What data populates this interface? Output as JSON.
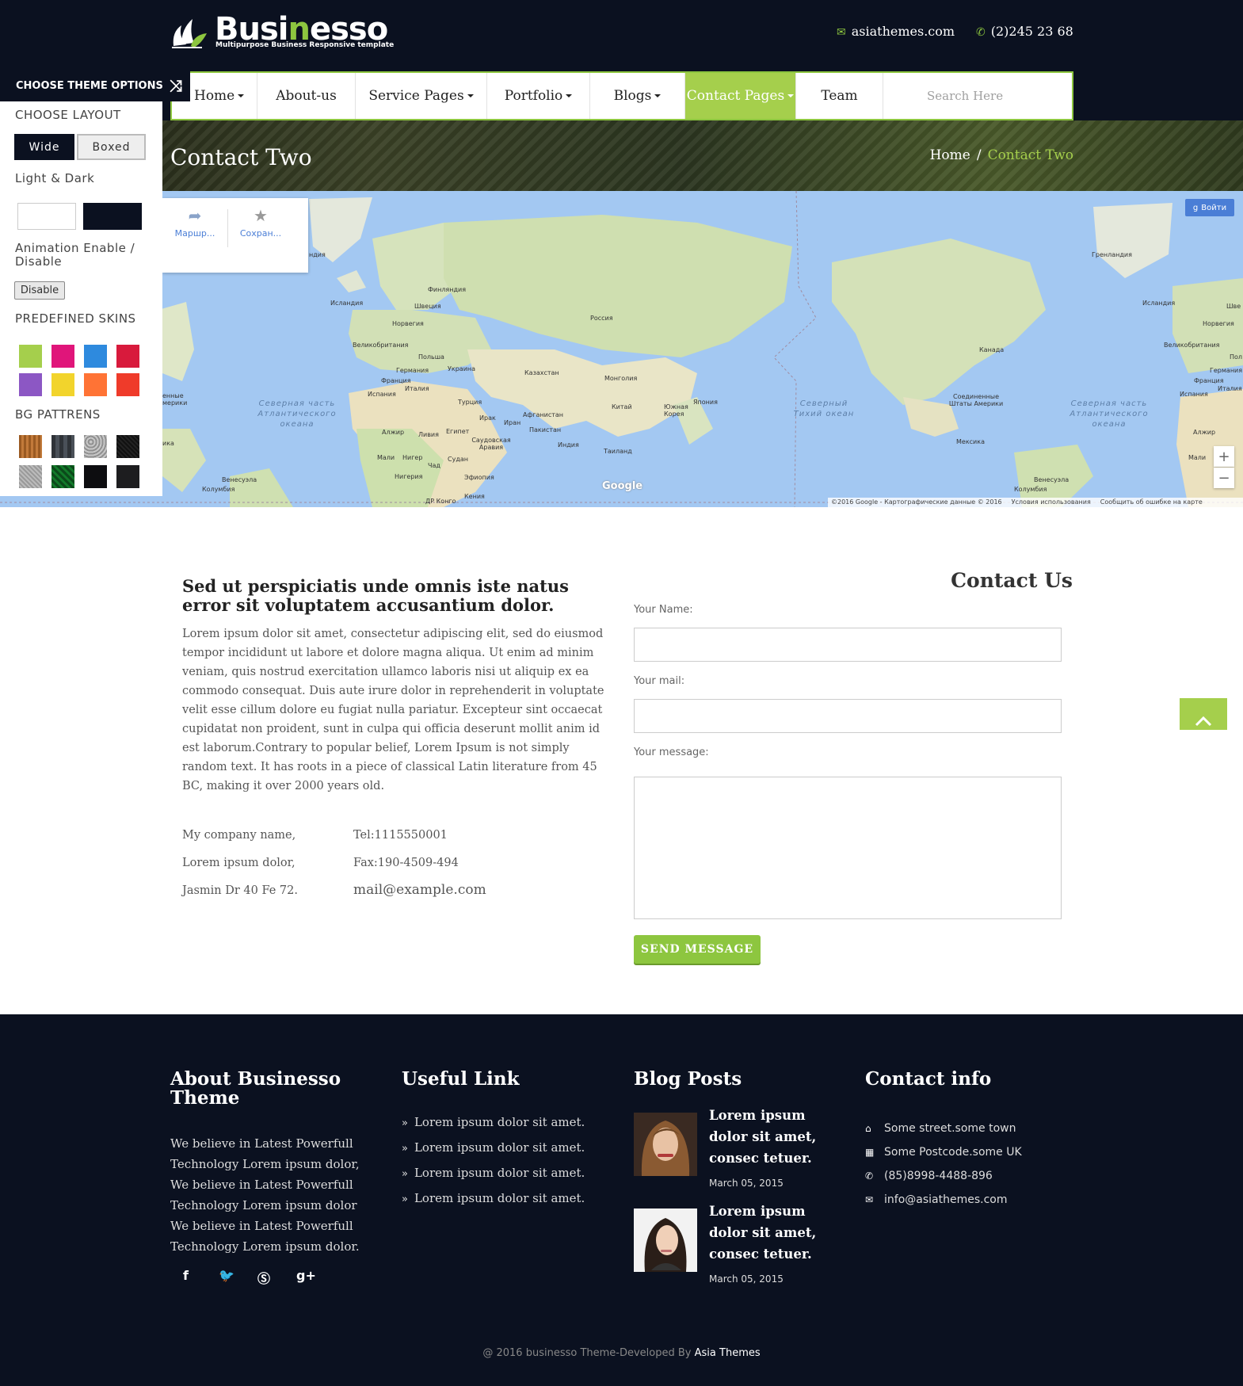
{
  "header": {
    "logo_main_pre": "Busi",
    "logo_main_accent": "n",
    "logo_main_post": "esso",
    "logo_tagline": "Multipurpose Business Responsive template",
    "email": "asiathemes.com",
    "phone": "(2)245 23 68"
  },
  "nav": {
    "items": [
      {
        "label": "Home",
        "dropdown": true
      },
      {
        "label": "About-us",
        "dropdown": false
      },
      {
        "label": "Service Pages",
        "dropdown": true
      },
      {
        "label": "Portfolio",
        "dropdown": true
      },
      {
        "label": "Blogs",
        "dropdown": true
      },
      {
        "label": "Contact Pages",
        "dropdown": true,
        "active": true
      },
      {
        "label": "Team",
        "dropdown": false
      }
    ],
    "search_placeholder": "Search Here"
  },
  "banner": {
    "title": "Contact Two",
    "breadcrumb_home": "Home",
    "breadcrumb_sep": "/",
    "breadcrumb_current": "Contact Two"
  },
  "map": {
    "route_label": "Маршр...",
    "save_label": "Сохран...",
    "login_label": "Войти",
    "zoom_in": "+",
    "zoom_out": "−",
    "watermark": "Google",
    "attribution": [
      "©2016 Google - Картографические данные © 2016",
      "Условия использования",
      "Сообщить об ошибке на карте"
    ],
    "labels": {
      "greenland_l": "ндия",
      "iceland_l": "Исландия",
      "norway_l": "Норвегия",
      "sweden_l": "Швеция",
      "finland_l": "Финляндия",
      "russia": "Россия",
      "uk_l": "Великобритания",
      "poland": "Польша",
      "germany_l": "Германия",
      "ukraine": "Украина",
      "france_l": "Франция",
      "italy_l": "Италия",
      "spain_l": "Испания",
      "kazakhstan": "Казахстан",
      "mongolia": "Монголия",
      "turkey": "Турция",
      "china": "Китай",
      "skorea": "Южная Корея",
      "japan": "Япония",
      "iraq": "Ирак",
      "iran": "Иран",
      "afghanistan": "Афганистан",
      "pakistan": "Пакистан",
      "india": "Индия",
      "thailand": "Таиланд",
      "saudi": "Саудовская Аравия",
      "egypt": "Египет",
      "libya": "Ливия",
      "algeria_l": "Алжир",
      "mali_l": "Мали",
      "niger": "Нигер",
      "chad": "Чад",
      "sudan": "Судан",
      "nigeria": "Нигерия",
      "ethiopia": "Эфиопия",
      "kenya": "Кения",
      "drc": "ДР Конго",
      "venezuela_l": "Венесуэла",
      "colombia_l": "Колумбия",
      "na_l": "енные мерики",
      "africa_l": "ика",
      "greenland_r": "Гренландия",
      "iceland_r": "Исландия",
      "norway_r": "Норвегия",
      "uk_r": "Великобритания",
      "germany_r": "Германия",
      "france_r": "Франция",
      "italy_r": "Италия",
      "spain_r": "Испания",
      "canada": "Канада",
      "usa": "Соединенные Штаты Америки",
      "mexico": "Мексика",
      "venezuela_r": "Венесуэла",
      "colombia_r": "Колумбия",
      "algeria_r": "Алжир",
      "mali_r": "Мали",
      "shve_r": "Шве",
      "pol_r": "Пол",
      "atl_l": "Северная часть Атлантического океана",
      "pacific": "Северный Тихий океан",
      "atl_r": "Северная часть Атлантического океана"
    }
  },
  "theme_panel": {
    "title": "CHOOSE THEME OPTIONS",
    "choose_layout": "CHOOSE LAYOUT",
    "wide": "Wide",
    "boxed": "Boxed",
    "light_dark": "Light & Dark",
    "animation": "Animation Enable / Disable",
    "disable": "Disable",
    "predefined_skins": "PREDEFINED SKINS",
    "bg_patterns": "BG PATTRENS",
    "skins": [
      "#a5cf4c",
      "#e0157a",
      "#2e8ade",
      "#d81a3c",
      "#8c57c4",
      "#f2d42c",
      "#ff7335",
      "#ef3b2a"
    ]
  },
  "content": {
    "heading": "Sed ut perspiciatis unde omnis iste natus error sit voluptatem accusantium dolor.",
    "paragraph": "Lorem ipsum dolor sit amet, consectetur adipiscing elit, sed do eiusmod tempor incididunt ut labore et dolore magna aliqua. Ut enim ad minim veniam, quis nostrud exercitation ullamco laboris nisi ut aliquip ex ea commodo consequat. Duis aute irure dolor in reprehenderit in voluptate velit esse cillum dolore eu fugiat nulla pariatur. Excepteur sint occaecat cupidatat non proident, sunt in culpa qui officia deserunt mollit anim id est laborum.Contrary to popular belief, Lorem Ipsum is not simply random text. It has roots in a piece of classical Latin literature from 45 BC, making it over 2000 years old.",
    "address": {
      "company": "My company name,",
      "line2": "Lorem ipsum dolor,",
      "line3": "Jasmin Dr 40 Fe 72.",
      "tel": "Tel:1115550001",
      "fax": "Fax:190-4509-494",
      "mail": "mail@example.com"
    }
  },
  "form": {
    "title": "Contact Us",
    "name_label": "Your Name:",
    "mail_label": "Your mail:",
    "message_label": "Your message:",
    "name_value": "",
    "mail_value": "",
    "message_value": "",
    "send": "SEND MESSAGE"
  },
  "footer": {
    "about_title": "About Businesso Theme",
    "about_text": "We believe in Latest Powerfull Technology Lorem ipsum dolor, We believe in Latest Powerfull Technology Lorem ipsum dolor We believe in Latest Powerfull Technology Lorem ipsum dolor.",
    "useful_title": "Useful Link",
    "links": [
      "Lorem ipsum dolor sit amet.",
      "Lorem ipsum dolor sit amet.",
      "Lorem ipsum dolor sit amet.",
      "Lorem ipsum dolor sit amet."
    ],
    "blog_title": "Blog Posts",
    "posts": [
      {
        "title": "Lorem ipsum dolor sit amet, consec tetuer.",
        "date": "March 05, 2015"
      },
      {
        "title": "Lorem ipsum dolor sit amet, consec tetuer.",
        "date": "March 05, 2015"
      }
    ],
    "contact_title": "Contact info",
    "contact": {
      "street": "Some street.some town",
      "postcode": "Some Postcode.some UK",
      "phone": "(85)8998-4488-896",
      "email": "info@asiathemes.com"
    },
    "copyright": "@ 2016 businesso Theme-Developed By",
    "copyright_brand": "Asia Themes"
  },
  "colors": {
    "accent": "#8dc63f",
    "dark": "#0b1120"
  }
}
